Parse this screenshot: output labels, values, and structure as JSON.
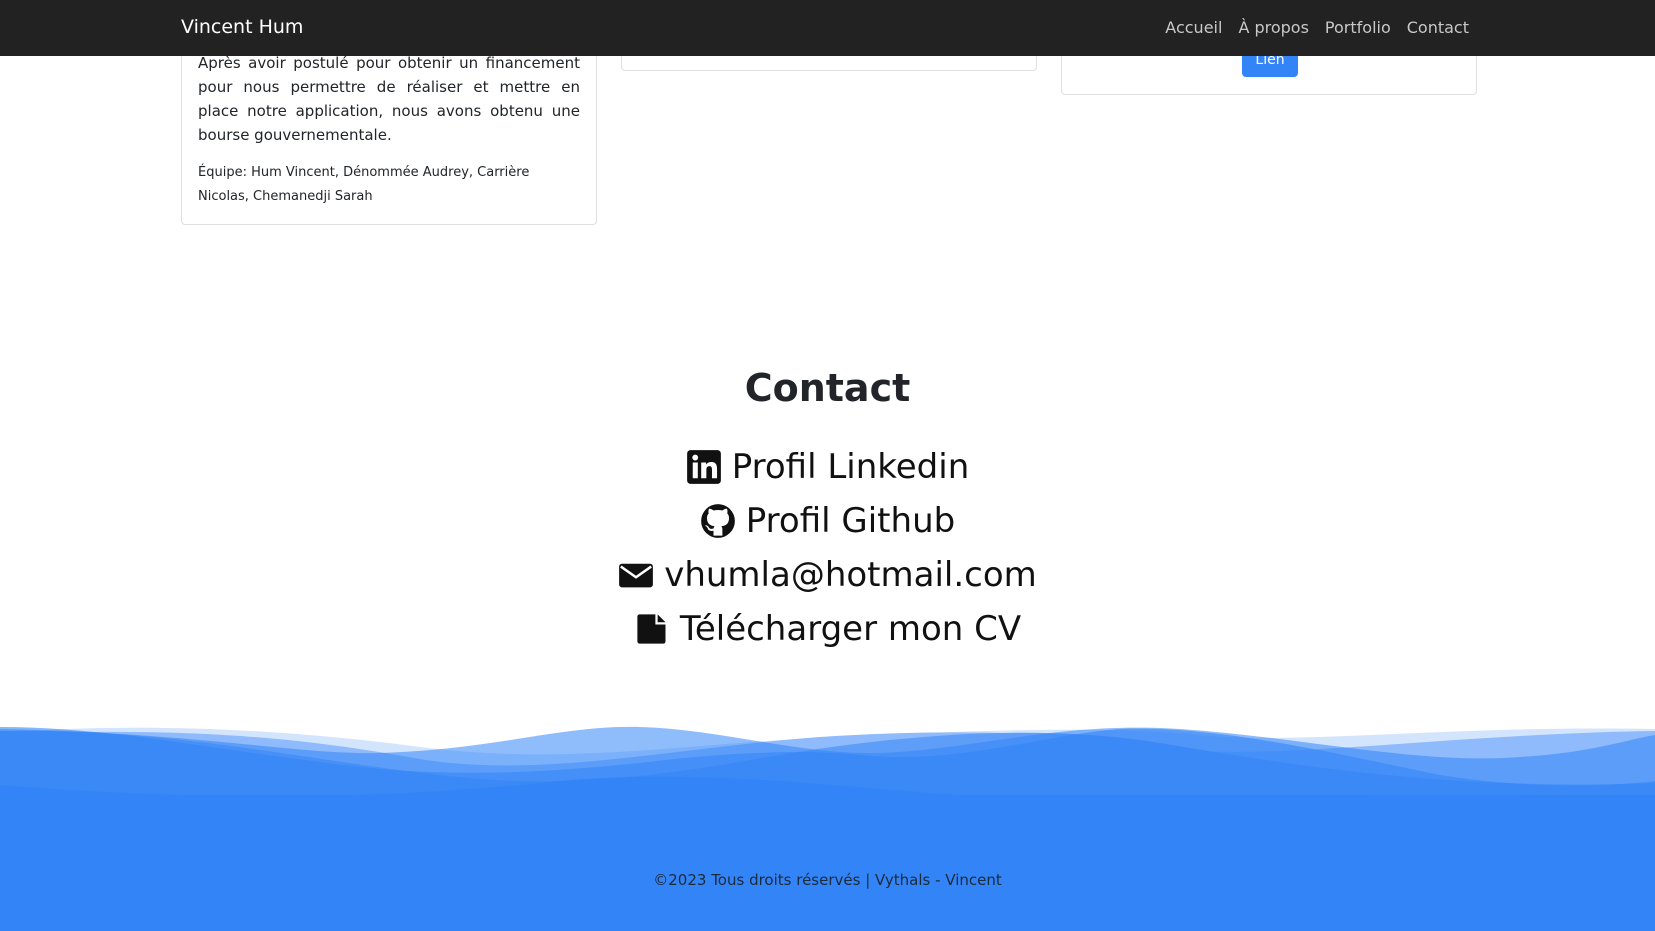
{
  "navbar": {
    "brand": "Vincent Hum",
    "links": [
      "Accueil",
      "À propos",
      "Portfolio",
      "Contact"
    ]
  },
  "project_card": {
    "description": "Après avoir postulé pour obtenir un financement pour nous permettre de réaliser et mettre en place notre application, nous avons obtenu une bourse gouvernementale.",
    "team": "Équipe: Hum Vincent, Dénommée Audrey, Carrière Nicolas, Chemanedji Sarah"
  },
  "right_card": {
    "button_label": "Lien"
  },
  "contact": {
    "title": "Contact",
    "items": [
      {
        "icon": "linkedin-icon",
        "label": "Profil Linkedin"
      },
      {
        "icon": "github-icon",
        "label": "Profil Github"
      },
      {
        "icon": "envelope-icon",
        "label": "vhumla@hotmail.com"
      },
      {
        "icon": "file-icon",
        "label": "Télécharger mon CV"
      }
    ]
  },
  "footer": {
    "text": "©2023 Tous droits réservés | Vythals - Vincent",
    "colors": {
      "wave_main": "#3385f7",
      "wave_light": "#8fbafb",
      "wave_pale": "#d3e4fd"
    }
  },
  "colors": {
    "navbar_bg": "#222222",
    "accent": "#3385f7"
  }
}
